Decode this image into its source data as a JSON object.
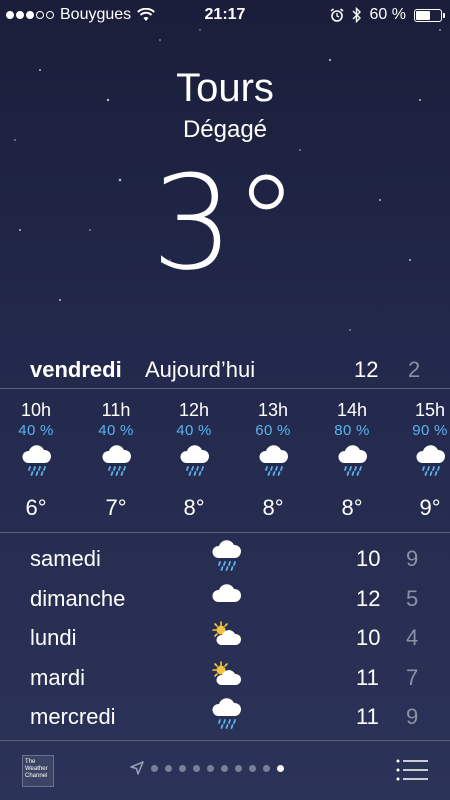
{
  "status_bar": {
    "carrier": "Bouygues",
    "time": "21:17",
    "battery_text": "60 %",
    "battery_level": 0.6,
    "signal_bars_full": 3,
    "signal_bars_total": 5
  },
  "location": {
    "city": "Tours",
    "condition": "Dégagé",
    "temperature": "3°"
  },
  "today": {
    "day": "vendredi",
    "label": "Aujourd’hui",
    "high": "12",
    "low": "2"
  },
  "hourly": [
    {
      "hour": "10h",
      "precip": "40 %",
      "icon": "rain-cloud-icon",
      "temp": "6°"
    },
    {
      "hour": "11h",
      "precip": "40 %",
      "icon": "rain-cloud-icon",
      "temp": "7°"
    },
    {
      "hour": "12h",
      "precip": "40 %",
      "icon": "rain-cloud-icon",
      "temp": "8°"
    },
    {
      "hour": "13h",
      "precip": "60 %",
      "icon": "rain-cloud-icon",
      "temp": "8°"
    },
    {
      "hour": "14h",
      "precip": "80 %",
      "icon": "rain-cloud-icon",
      "temp": "8°"
    },
    {
      "hour": "15h",
      "precip": "90 %",
      "icon": "rain-cloud-icon",
      "temp": "9°"
    }
  ],
  "daily": [
    {
      "day": "samedi",
      "icon": "rain-cloud-icon",
      "high": "10",
      "low": "9"
    },
    {
      "day": "dimanche",
      "icon": "cloud-icon",
      "high": "12",
      "low": "5"
    },
    {
      "day": "lundi",
      "icon": "partly-sunny-icon",
      "high": "10",
      "low": "4"
    },
    {
      "day": "mardi",
      "icon": "partly-sunny-icon",
      "high": "11",
      "low": "7"
    },
    {
      "day": "mercredi",
      "icon": "rain-cloud-icon",
      "high": "11",
      "low": "9"
    }
  ],
  "footer": {
    "provider_logo_text": "The Weather Channel",
    "page_count": 10,
    "active_page": 9
  },
  "colors": {
    "precip_blue": "#5ab3ec",
    "low_temp_gray": "#8c90a6"
  }
}
